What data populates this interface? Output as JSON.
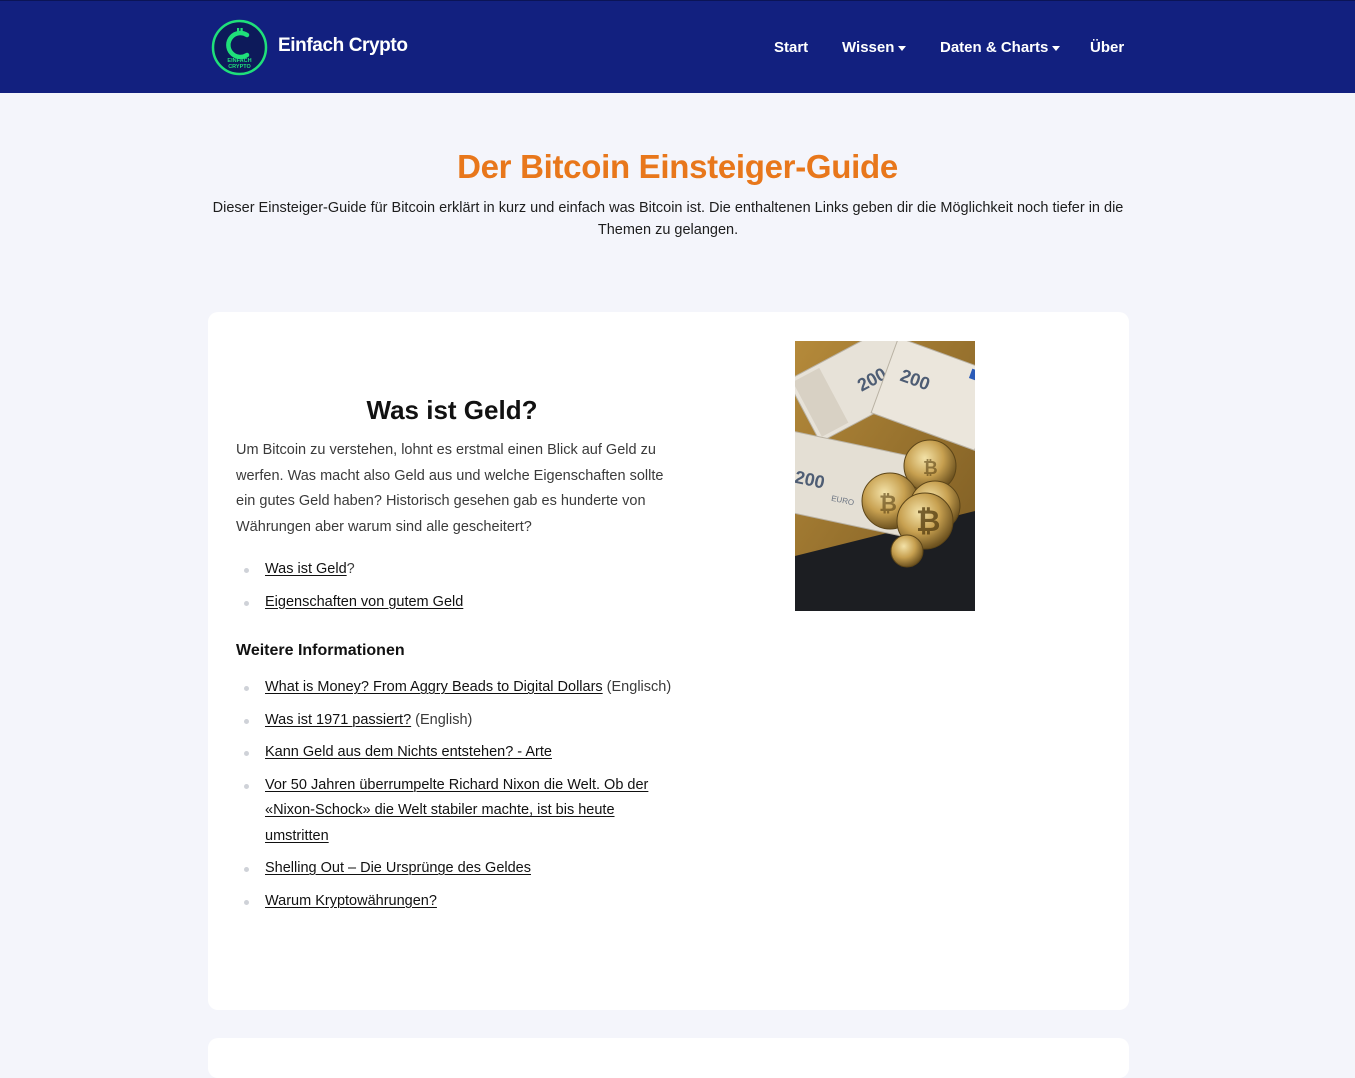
{
  "header": {
    "brand": "Einfach Crypto",
    "logo_text_top": "EINFACH",
    "logo_text_bottom": "CRYPTO",
    "nav": [
      {
        "label": "Start"
      },
      {
        "label": "Wissen"
      },
      {
        "label": "Daten & Charts"
      },
      {
        "label": "Über"
      }
    ]
  },
  "hero": {
    "title": "Der Bitcoin Einsteiger-Guide",
    "description": "Dieser Einsteiger-Guide für Bitcoin erklärt in kurz und einfach was Bitcoin ist. Die enthaltenen Links geben dir die Möglichkeit noch tiefer in die Themen zu gelangen."
  },
  "section": {
    "title": "Was ist Geld?",
    "body": "Um Bitcoin zu verstehen, lohnt es erstmal einen Blick auf Geld zu werfen. Was macht also Geld aus und welche Eigenschaften sollte ein gutes Geld haben? Historisch gesehen gab es hunderte von Währungen aber warum sind alle gescheitert?",
    "links": [
      {
        "label": "Was ist Geld",
        "suffix": "?"
      },
      {
        "label": "Eigenschaften von gutem Geld",
        "suffix": ""
      }
    ],
    "more_heading": "Weitere Informationen",
    "more_links": [
      {
        "label": "What is Money? From Aggry Beads to Digital Dollars",
        "suffix": " (Englisch)"
      },
      {
        "label": "Was ist 1971 passiert?",
        "suffix": " (English)"
      },
      {
        "label": "Kann Geld aus dem Nichts entstehen? - Arte",
        "suffix": ""
      },
      {
        "label": "Vor 50 Jahren überrumpelte Richard Nixon die Welt. Ob der «Nixon-Schock» die Welt stabiler machte, ist bis heute umstritten",
        "suffix": ""
      },
      {
        "label": "Shelling Out – Die Ursprünge des Geldes",
        "suffix": ""
      },
      {
        "label": "Warum Kryptowährungen?",
        "suffix": ""
      }
    ],
    "photo_banknote_value": "200",
    "photo_banknote_currency": "EURO"
  },
  "colors": {
    "header_bg": "#12207f",
    "accent_orange": "#e8771b",
    "logo_green": "#1fe07a",
    "page_bg": "#f4f5fb"
  }
}
